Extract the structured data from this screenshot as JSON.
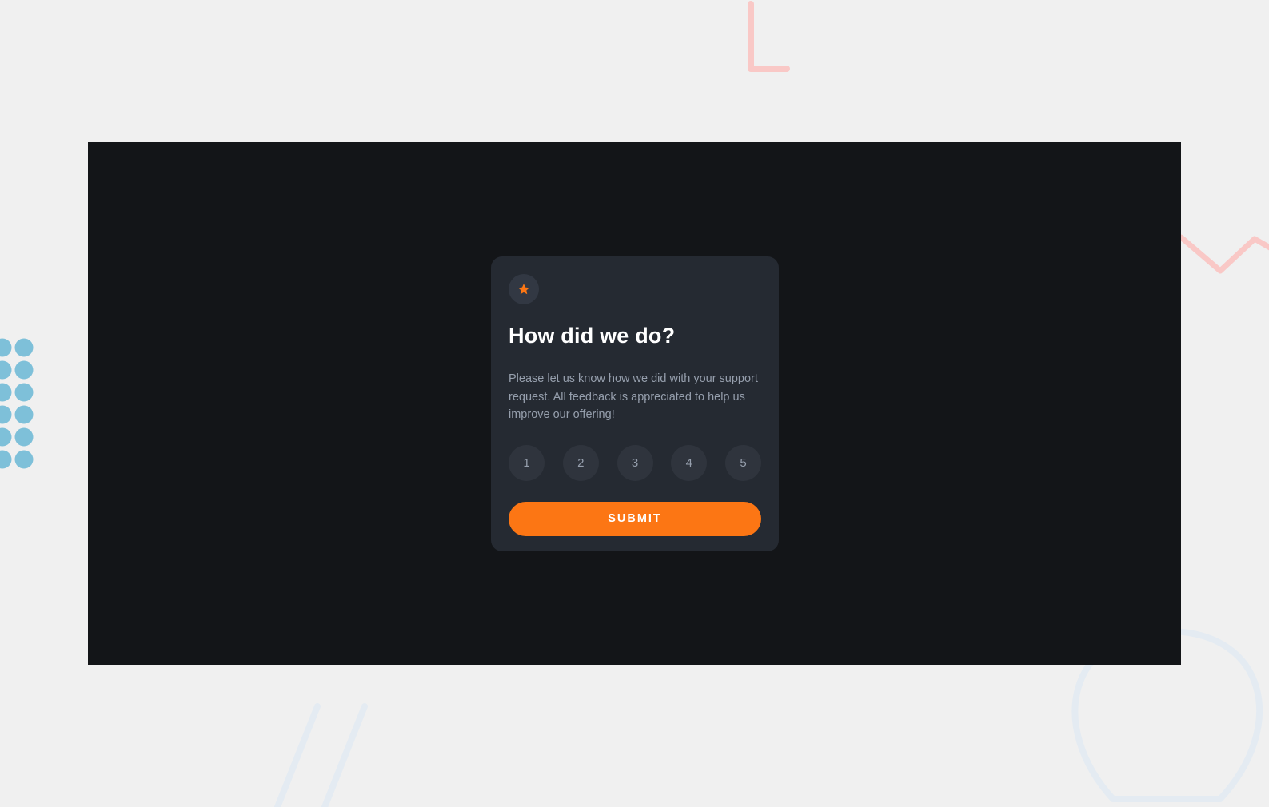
{
  "card": {
    "title": "How did we do?",
    "description": "Please let us know how we did with your support request. All feedback is appreciated to help us improve our offering!",
    "ratings": [
      "1",
      "2",
      "3",
      "4",
      "5"
    ],
    "submit_label": "SUBMIT",
    "icon": "star-icon"
  },
  "colors": {
    "page_background": "#f0f0f0",
    "stage_background": "#131518",
    "card_background": "#252a32",
    "accent": "#fc7614",
    "rating_background": "#2f343d",
    "text_muted": "#969fad",
    "decor_dots": "#7ec0d9",
    "decor_pink": "#f9c8c6",
    "decor_light_blue": "#e4ebf2"
  }
}
